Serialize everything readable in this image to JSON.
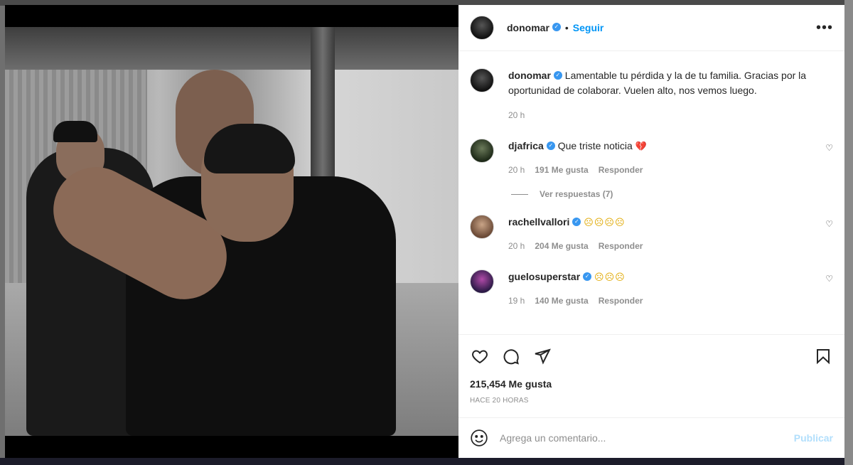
{
  "post": {
    "author": "donomar",
    "follow_label": "Seguir",
    "separator": "•",
    "more_label": "•••"
  },
  "caption": {
    "author": "donomar",
    "text": "Lamentable tu pérdida y la de tu familia. Gracias por la oportunidad de colaborar. Vuelen alto, nos vemos luego.",
    "time": "20 h"
  },
  "comments": [
    {
      "user": "djafrica",
      "text": "Que triste noticia",
      "emoji": "💔",
      "time": "20 h",
      "likes": "191 Me gusta",
      "reply_label": "Responder",
      "view_replies": "Ver respuestas (7)"
    },
    {
      "user": "rachellvallori",
      "text": "",
      "emoji": "☹☹☹☹",
      "time": "20 h",
      "likes": "204 Me gusta",
      "reply_label": "Responder"
    },
    {
      "user": "guelosuperstar",
      "text": "",
      "emoji": "☹☹☹",
      "time": "19 h",
      "likes": "140 Me gusta",
      "reply_label": "Responder"
    }
  ],
  "likes_count": "215,454 Me gusta",
  "posted_ago": "HACE 20 HORAS",
  "comment_box": {
    "placeholder": "Agrega un comentario...",
    "publish_label": "Publicar"
  },
  "icons": [
    "heart-icon",
    "comment-icon",
    "share-icon",
    "bookmark-icon",
    "emoji-icon",
    "more-icon",
    "verified-icon"
  ]
}
